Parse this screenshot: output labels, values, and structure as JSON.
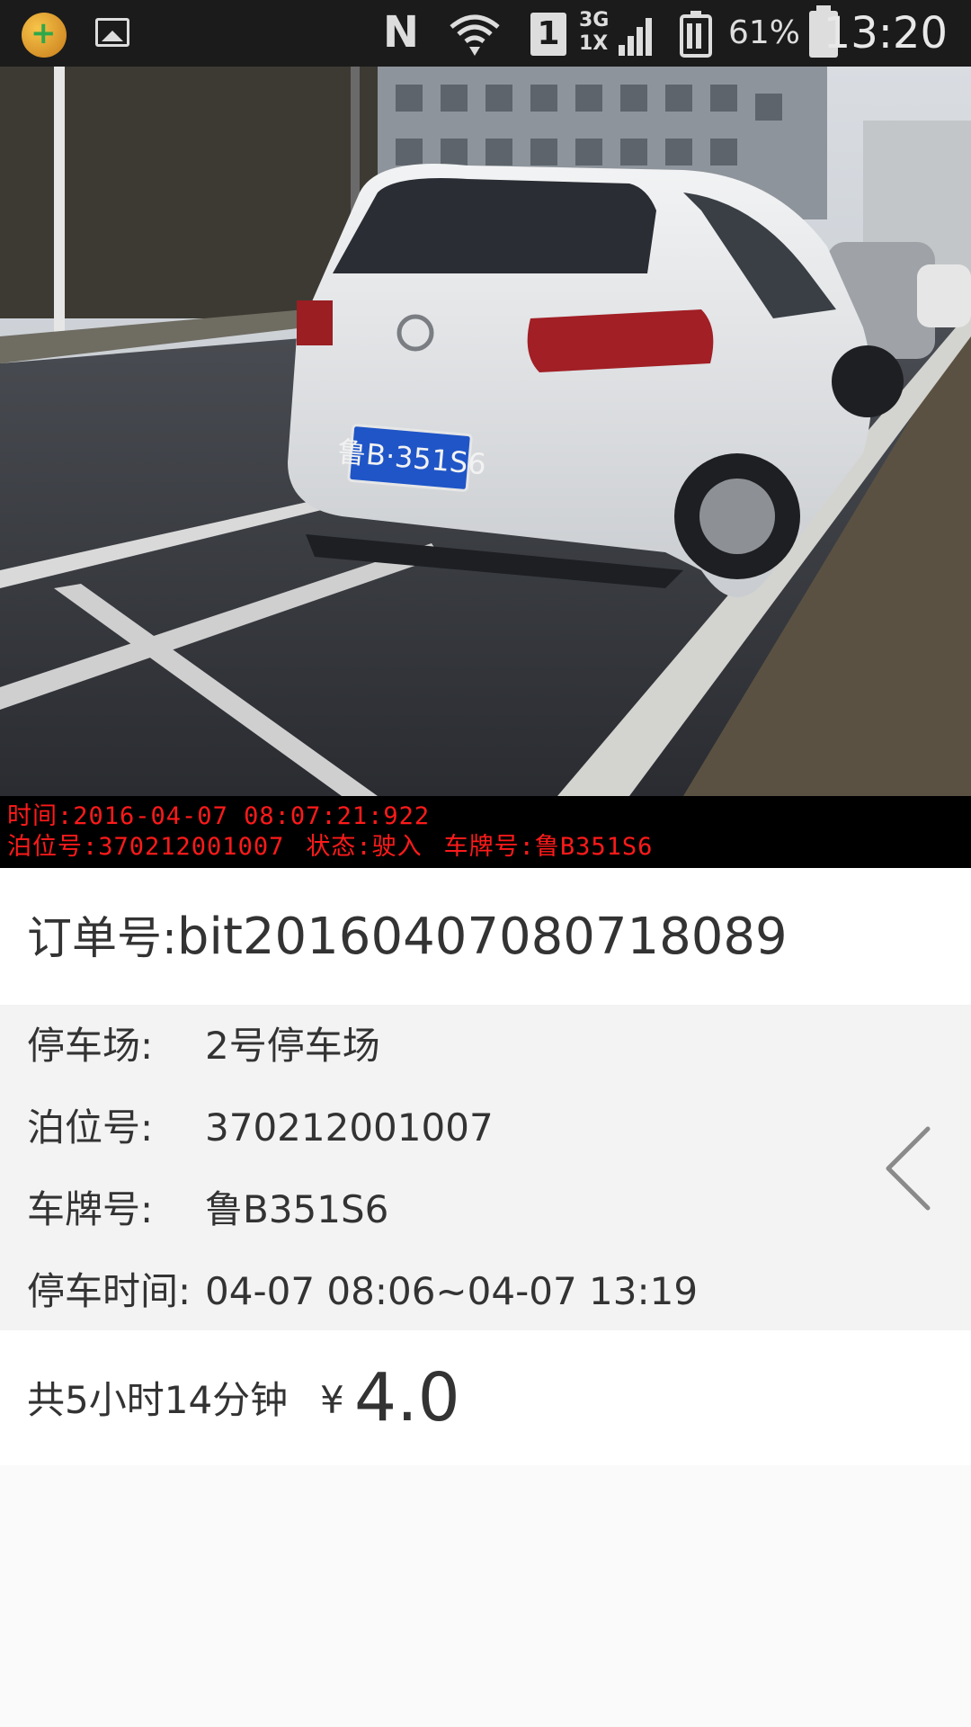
{
  "status_bar": {
    "network_label_top": "3G",
    "network_label_bottom": "1X",
    "sim_slot": "1",
    "battery_percent": "61%",
    "time": "13:20",
    "icons": [
      "app-notification-icon",
      "gallery-icon",
      "nfc-icon",
      "wifi-icon",
      "sim-icon",
      "signal-icon",
      "battery-saver-icon",
      "battery-icon"
    ]
  },
  "photo": {
    "plate_text": "鲁B·351S6",
    "overlay_line1": {
      "time_label": "时间:",
      "time_value": "2016-04-07  08:07:21:922"
    },
    "overlay_line2": {
      "berth_label": "泊位号:",
      "berth_value": "370212001007",
      "status_label": "状态:",
      "status_value": "驶入",
      "plate_label": "车牌号:",
      "plate_value": "鲁B351S6"
    }
  },
  "order": {
    "label": "订单号:",
    "number": "bit20160407080718089"
  },
  "details": [
    {
      "label": "停车场:",
      "value": "2号停车场"
    },
    {
      "label": "泊位号:",
      "value": "370212001007"
    },
    {
      "label": "车牌号:",
      "value": "鲁B351S6"
    },
    {
      "label": "停车时间:",
      "value": "04-07 08:06~04-07 13:19"
    }
  ],
  "total": {
    "duration": "共5小时14分钟",
    "currency": "¥",
    "amount": "4.0"
  },
  "colors": {
    "status_bar_bg": "#1b1b1b",
    "overlay_text": "#ff1a1a",
    "detail_bg": "#f3f3f3"
  }
}
